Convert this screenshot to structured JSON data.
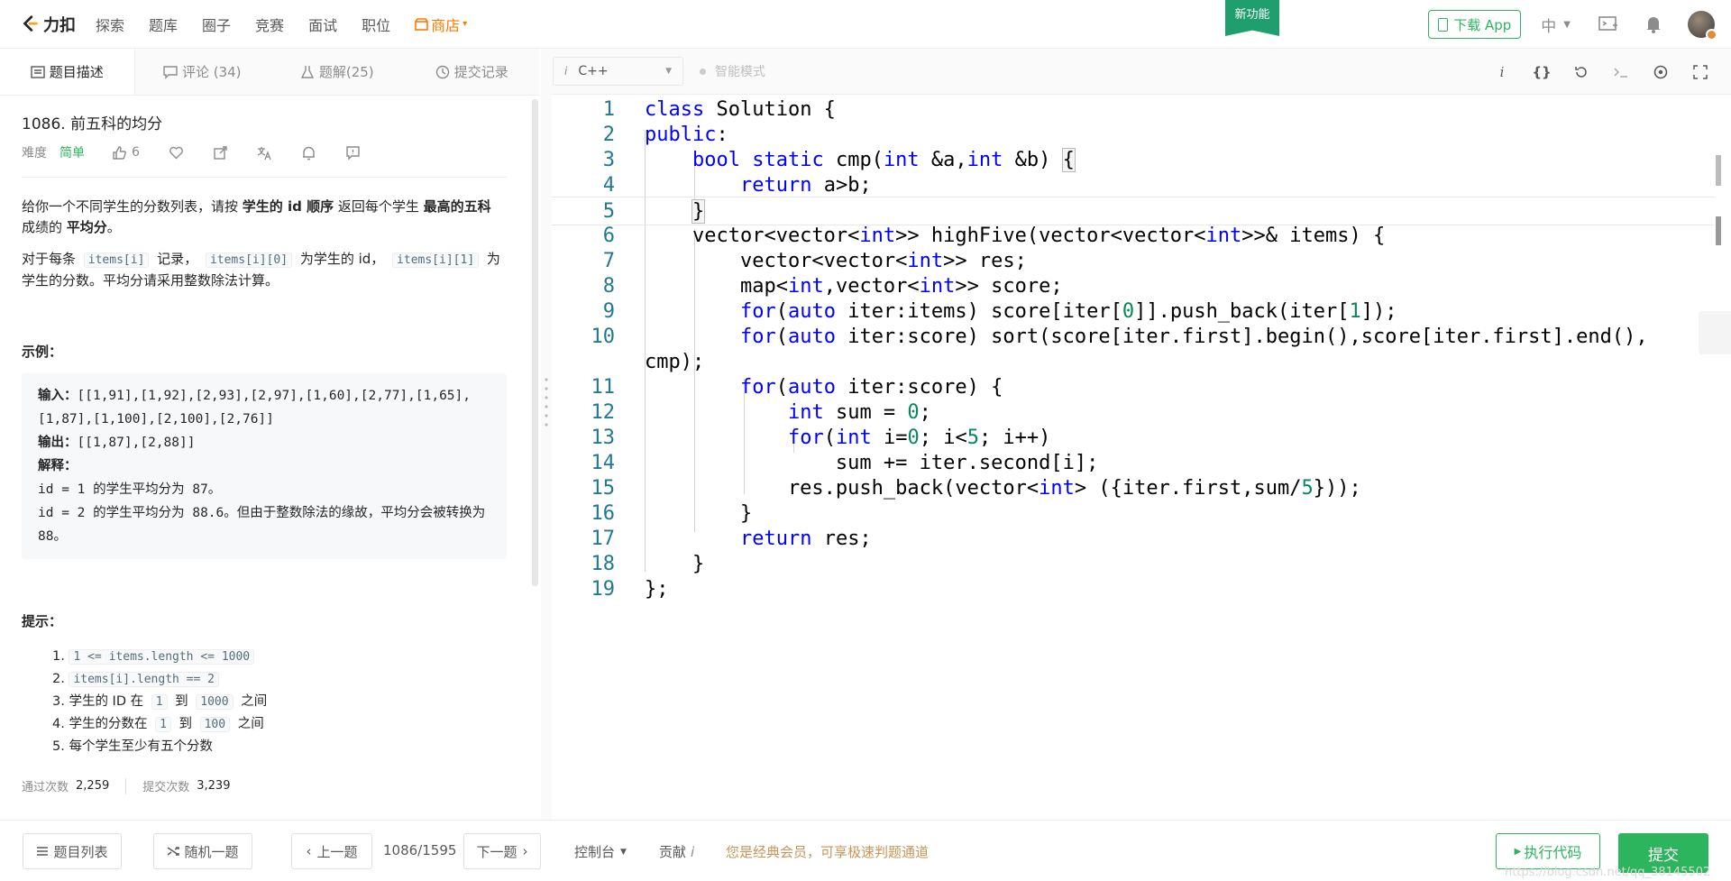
{
  "nav": {
    "logo": "力扣",
    "links": [
      "探索",
      "题库",
      "圈子",
      "竞赛",
      "面试",
      "职位"
    ],
    "store": "商店",
    "new_feature": "新功能",
    "download": "下载 App",
    "language": "中"
  },
  "left_tabs": [
    {
      "label": "题目描述",
      "icon": "description-icon"
    },
    {
      "label": "评论 (34)",
      "icon": "comment-icon"
    },
    {
      "label": "题解(25)",
      "icon": "solution-flask-icon"
    },
    {
      "label": "提交记录",
      "icon": "history-clock-icon"
    }
  ],
  "problem": {
    "title": "1086. 前五科的均分",
    "difficulty_label": "难度",
    "difficulty": "简单",
    "likes": "6",
    "desc1_a": "给你一个不同学生的分数列表，请按 ",
    "desc1_b": "学生的 id 顺序",
    "desc1_c": " 返回每个学生 ",
    "desc1_d": "最高的五科",
    "desc1_e": " 成绩的 ",
    "desc1_f": "平均分",
    "desc1_g": "。",
    "desc2_a": "对于每条 ",
    "desc2_code1": "items[i]",
    "desc2_b": " 记录， ",
    "desc2_code2": "items[i][0]",
    "desc2_c": " 为学生的 id， ",
    "desc2_code3": "items[i][1]",
    "desc2_d": " 为学生的分数。平均分请采用整数除法计算。",
    "example_heading": "示例：",
    "example_input_label": "输入：",
    "example_input": "[[1,91],[1,92],[2,93],[2,97],[1,60],[2,77],[1,65],[1,87],[1,100],[2,100],[2,76]]",
    "example_output_label": "输出：",
    "example_output": "[[1,87],[2,88]]",
    "example_expl_label": "解释：",
    "example_expl1": "id = 1 的学生平均分为 87。",
    "example_expl2": "id = 2 的学生平均分为 88.6。但由于整数除法的缘故，平均分会被转换为 88。",
    "hints_heading": "提示：",
    "hints": [
      {
        "n": "1.",
        "pre": "",
        "code": "1 <= items.length <= 1000",
        "post": "",
        "code2": "",
        "post2": ""
      },
      {
        "n": "2.",
        "pre": "",
        "code": "items[i].length == 2",
        "post": "",
        "code2": "",
        "post2": ""
      },
      {
        "n": "3.",
        "pre": "学生的 ID 在 ",
        "code": "1",
        "post": " 到 ",
        "code2": "1000",
        "post2": " 之间"
      },
      {
        "n": "4.",
        "pre": "学生的分数在 ",
        "code": "1",
        "post": " 到 ",
        "code2": "100",
        "post2": " 之间"
      },
      {
        "n": "5.",
        "pre": "每个学生至少有五个分数",
        "code": "",
        "post": "",
        "code2": "",
        "post2": ""
      }
    ],
    "accepted_label": "通过次数",
    "accepted": "2,259",
    "submitted_label": "提交次数",
    "submitted": "3,239"
  },
  "editor_toolbar": {
    "language": "C++",
    "smart_mode": "智能模式"
  },
  "code_lines": [
    {
      "n": "1"
    },
    {
      "n": "2"
    },
    {
      "n": "3"
    },
    {
      "n": "4"
    },
    {
      "n": "5"
    },
    {
      "n": "6"
    },
    {
      "n": "7"
    },
    {
      "n": "8"
    },
    {
      "n": "9"
    },
    {
      "n": "10"
    },
    {
      "n": "11"
    },
    {
      "n": "12"
    },
    {
      "n": "13"
    },
    {
      "n": "14"
    },
    {
      "n": "15"
    },
    {
      "n": "16"
    },
    {
      "n": "17"
    },
    {
      "n": "18"
    },
    {
      "n": "19"
    }
  ],
  "bottom": {
    "problem_list": "题目列表",
    "random": "随机一题",
    "prev": "上一题",
    "page": "1086/1595",
    "next": "下一题",
    "console": "控制台",
    "contribute": "贡献",
    "vip_notice": "您是经典会员，可享极速判题通道",
    "run": "执行代码",
    "submit": "提交",
    "watermark": "https://blog.csdn.net/qq_38145502"
  }
}
